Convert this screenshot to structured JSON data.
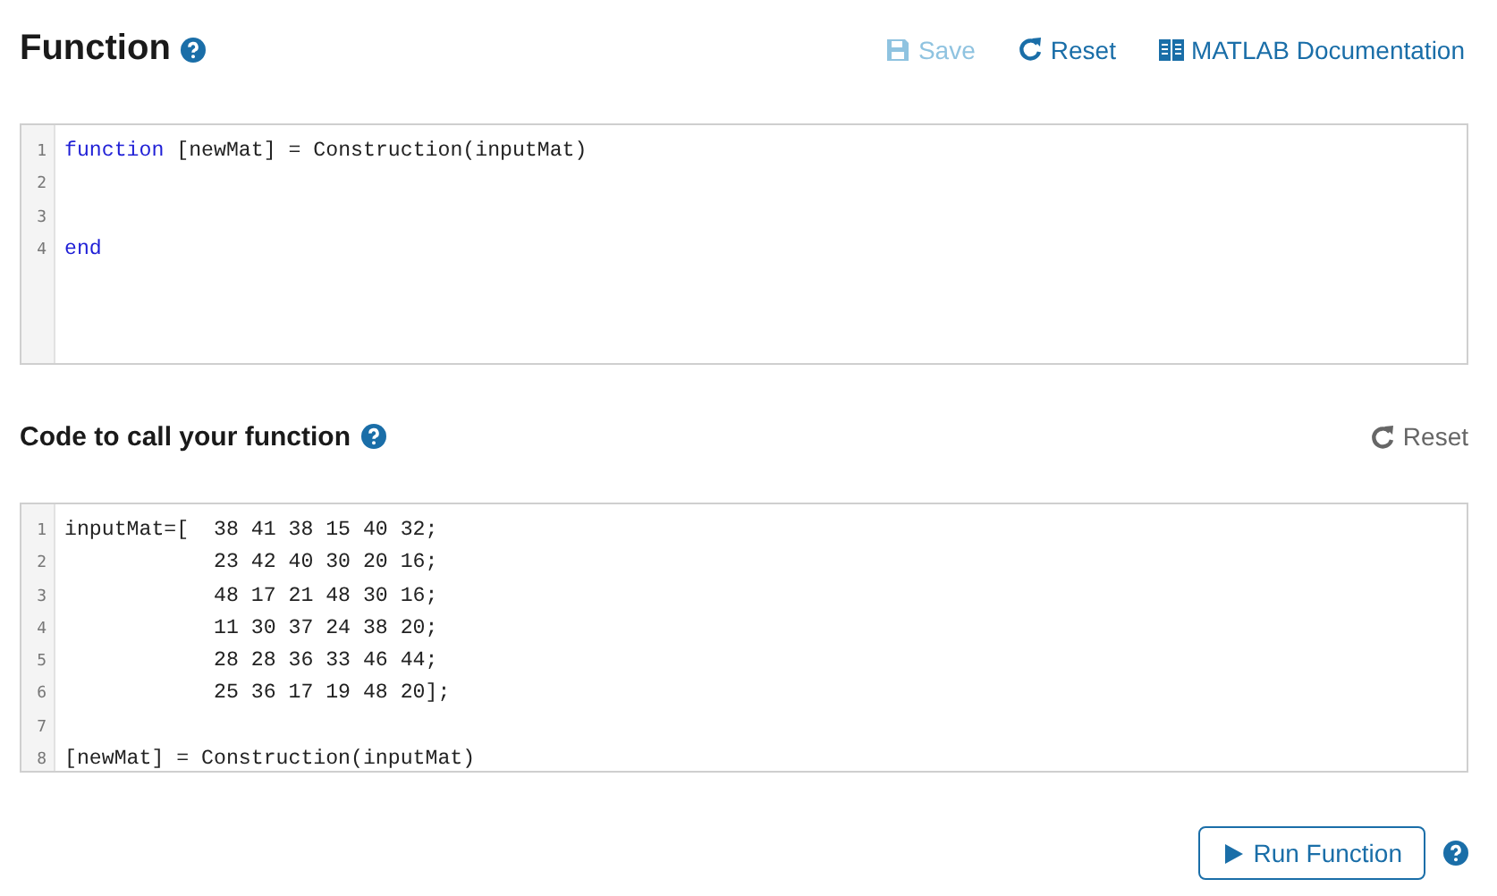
{
  "function_section": {
    "title": "Function",
    "actions": [
      {
        "kind": "save",
        "label": "Save",
        "disabled": true
      },
      {
        "kind": "reset",
        "label": "Reset",
        "disabled": false
      },
      {
        "kind": "docs",
        "label": "MATLAB Documentation",
        "disabled": false
      }
    ],
    "editor": {
      "lines": [
        {
          "number": "1",
          "tokens": [
            {
              "kind": "keyword",
              "text": "function"
            },
            {
              "kind": "plain",
              "text": " [newMat] = Construction(inputMat)"
            }
          ]
        },
        {
          "number": "2"
        },
        {
          "number": "3"
        },
        {
          "number": "4",
          "tokens": [
            {
              "kind": "keyword",
              "text": "end"
            }
          ]
        }
      ]
    }
  },
  "call_section": {
    "title": "Code to call your function",
    "actions": [
      {
        "kind": "reset",
        "label": "Reset",
        "disabled": false
      }
    ],
    "editor": {
      "lines": [
        {
          "number": "1",
          "tokens": [
            {
              "kind": "plain",
              "text": "inputMat=[  38 41 38 15 40 32;"
            }
          ]
        },
        {
          "number": "2",
          "tokens": [
            {
              "kind": "plain",
              "text": "            23 42 40 30 20 16;"
            }
          ]
        },
        {
          "number": "3",
          "tokens": [
            {
              "kind": "plain",
              "text": "            48 17 21 48 30 16;"
            }
          ]
        },
        {
          "number": "4",
          "tokens": [
            {
              "kind": "plain",
              "text": "            11 30 37 24 38 20;"
            }
          ]
        },
        {
          "number": "5",
          "tokens": [
            {
              "kind": "plain",
              "text": "            28 28 36 33 46 44;"
            }
          ]
        },
        {
          "number": "6",
          "tokens": [
            {
              "kind": "plain",
              "text": "            25 36 17 19 48 20];"
            }
          ]
        },
        {
          "number": "7"
        },
        {
          "number": "8",
          "tokens": [
            {
              "kind": "plain",
              "text": "[newMat] = Construction(inputMat)"
            }
          ]
        }
      ]
    }
  },
  "run_button": {
    "label": "Run Function"
  }
}
